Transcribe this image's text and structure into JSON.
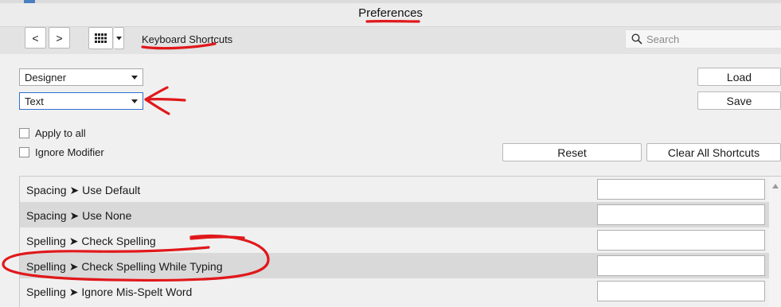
{
  "window": {
    "title": "Preferences"
  },
  "toolbar": {
    "back_label": "<",
    "forward_label": ">",
    "breadcrumb": "Keyboard Shortcuts",
    "search_placeholder": "Search"
  },
  "controls": {
    "category_select": "Designer",
    "group_select": "Text",
    "load_label": "Load",
    "save_label": "Save",
    "apply_to_all_label": "Apply to all",
    "ignore_modifier_label": "Ignore Modifier",
    "reset_label": "Reset",
    "clear_all_label": "Clear All Shortcuts"
  },
  "shortcuts": [
    {
      "label": "Spacing ➤ Use Default",
      "shortcut": ""
    },
    {
      "label": "Spacing ➤ Use None",
      "shortcut": ""
    },
    {
      "label": "Spelling ➤ Check Spelling",
      "shortcut": ""
    },
    {
      "label": "Spelling ➤ Check Spelling While Typing",
      "shortcut": ""
    },
    {
      "label": "Spelling ➤ Ignore Mis-Spelt Word",
      "shortcut": ""
    }
  ],
  "colors": {
    "annotation": "#e0181b",
    "focus_border": "#2f6fd1"
  }
}
